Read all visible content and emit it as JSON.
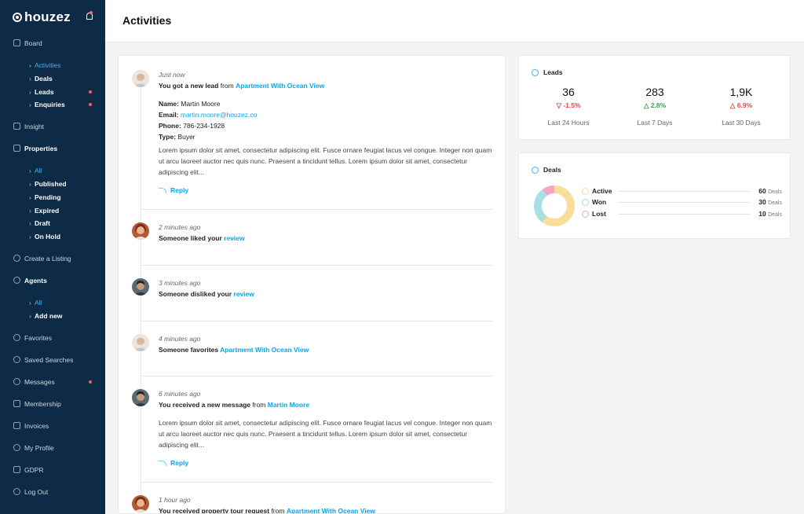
{
  "app": {
    "brand": "houzez",
    "page_title": "Activities"
  },
  "sidebar": {
    "board": "Board",
    "board_sub": [
      "Activities",
      "Deals",
      "Leads",
      "Enquiries"
    ],
    "insight": "Insight",
    "properties": "Properties",
    "properties_sub": [
      "All",
      "Published",
      "Pending",
      "Expired",
      "Draft",
      "On Hold"
    ],
    "create_listing": "Create a Listing",
    "agents": "Agents",
    "agents_sub": [
      "All",
      "Add new"
    ],
    "favorites": "Favorites",
    "saved_searches": "Saved Searches",
    "messages": "Messages",
    "membership": "Membership",
    "invoices": "Invoices",
    "my_profile": "My Profile",
    "gdpr": "GDPR",
    "log_out": "Log Out"
  },
  "activities": [
    {
      "time": "Just now",
      "text": "You got a new lead",
      "connector": " from ",
      "link": "Apartment With Ocean View",
      "name_label": "Name:",
      "name": "Martin Moore",
      "email_label": "Email:",
      "email": "martin.moore@houzez.co",
      "phone_label": "Phone:",
      "phone": "786-234-1928",
      "type_label": "Type:",
      "type": "Buyer",
      "body": "Lorem ipsum dolor sit amet, consectetur adipiscing elit. Fusce ornare feugiat lacus vel congue. Integer non quam ut arcu laoreet auctor nec quis nunc. Praesent a tincidunt tellus. Lorem ipsum dolor sit amet, consectetur adipiscing elit...",
      "reply": "Reply"
    },
    {
      "time": "2 minutes ago",
      "text": "Someone liked your ",
      "link": "review"
    },
    {
      "time": "3 minutes ago",
      "text": "Someone disliked your ",
      "link": "review"
    },
    {
      "time": "4 minutes ago",
      "text": "Someone favorites ",
      "link": "Apartment With Ocean View"
    },
    {
      "time": "6 minutes ago",
      "text": "You received a new message",
      "connector": " from ",
      "link": "Martin Moore",
      "body": "Lorem ipsum dolor sit amet, consectetur adipiscing elit. Fusce ornare feugiat lacus vel congue. Integer non quam ut arcu laoreet auctor nec quis nunc. Praesent a tincidunt tellus. Lorem ipsum dolor sit amet, consectetur adipiscing elit...",
      "reply": "Reply"
    },
    {
      "time": "1 hour ago",
      "text": "You received property tour request",
      "connector": " from ",
      "link": "Apartment With Ocean View"
    }
  ],
  "leads": {
    "title": "Leads",
    "stats": [
      {
        "value": "36",
        "change": "-1.5%",
        "direction": "down",
        "period": "Last 24 Hours"
      },
      {
        "value": "283",
        "change": "2.8%",
        "direction": "up",
        "period": "Last 7 Days"
      },
      {
        "value": "1,9K",
        "change": "6.9%",
        "direction": "up-red",
        "period": "Last 30 Days"
      }
    ]
  },
  "deals": {
    "title": "Deals",
    "unit": "Deals",
    "items": [
      {
        "label": "Active",
        "value": 60,
        "color": "#f9dd9b"
      },
      {
        "label": "Won",
        "value": 30,
        "color": "#a8dfe2"
      },
      {
        "label": "Lost",
        "value": 10,
        "color": "#f5a6bf"
      }
    ]
  },
  "colors": {
    "sidebar": "#0d2b47",
    "accent": "#0aa5e8",
    "badge": "#ff5a5f"
  }
}
